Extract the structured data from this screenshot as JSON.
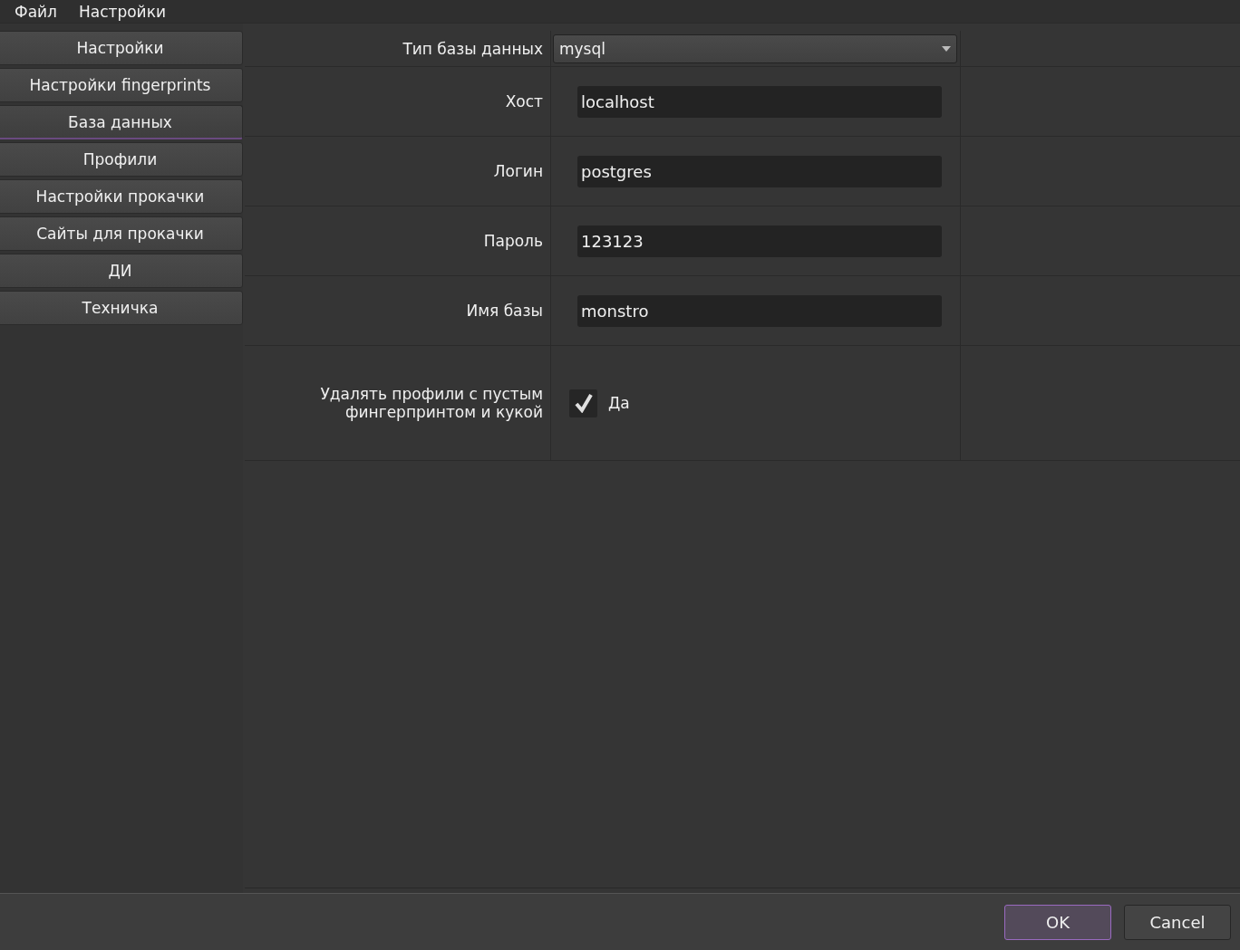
{
  "menu": [
    "Файл",
    "Настройки"
  ],
  "sidebar": {
    "items": [
      {
        "label": "Настройки",
        "selected": false
      },
      {
        "label": "Настройки fingerprints",
        "selected": false
      },
      {
        "label": "База данных",
        "selected": true
      },
      {
        "label": "Профили",
        "selected": false
      },
      {
        "label": "Настройки прокачки",
        "selected": false
      },
      {
        "label": "Сайты для прокачки",
        "selected": false
      },
      {
        "label": "ДИ",
        "selected": false
      },
      {
        "label": "Техничка",
        "selected": false
      }
    ]
  },
  "form": {
    "rows": [
      {
        "kind": "combo",
        "label": "Тип базы данных",
        "value": "mysql"
      },
      {
        "kind": "text",
        "label": "Хост",
        "value": "localhost"
      },
      {
        "kind": "text",
        "label": "Логин",
        "value": "postgres"
      },
      {
        "kind": "text",
        "label": "Пароль",
        "value": "123123"
      },
      {
        "kind": "text",
        "label": "Имя базы",
        "value": "monstro"
      },
      {
        "kind": "checkbox",
        "label": "Удалять профили с пустым фингерпринтом и кукой",
        "text": "Да",
        "checked": true
      }
    ]
  },
  "buttons": [
    {
      "label": "OK",
      "default": true
    },
    {
      "label": "Cancel",
      "default": false
    }
  ]
}
